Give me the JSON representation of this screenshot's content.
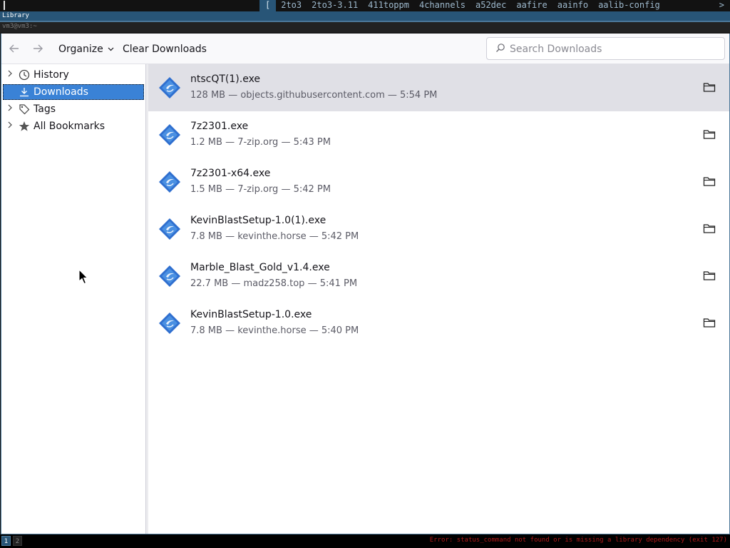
{
  "topbar": {
    "items": [
      "[",
      "2to3",
      "2to3-3.11",
      "411toppm",
      "4channels",
      "a52dec",
      "aafire",
      "aainfo",
      "aalib-config"
    ],
    "more": ">"
  },
  "window_title": "Library",
  "tab_title": "vm3@vm3:~",
  "toolbar": {
    "organize_label": "Organize",
    "clear_label": "Clear Downloads",
    "search_placeholder": "Search Downloads",
    "search_value": ""
  },
  "sidebar": {
    "items": [
      {
        "label": "History",
        "icon": "clock-icon",
        "expandable": true
      },
      {
        "label": "Downloads",
        "icon": "download-icon",
        "expandable": false,
        "selected": true
      },
      {
        "label": "Tags",
        "icon": "tag-icon",
        "expandable": true
      },
      {
        "label": "All Bookmarks",
        "icon": "star-icon",
        "expandable": true
      }
    ]
  },
  "downloads": [
    {
      "name": "ntscQT(1).exe",
      "meta": "128 MB — objects.githubusercontent.com — 5:54 PM",
      "selected": true
    },
    {
      "name": "7z2301.exe",
      "meta": "1.2 MB — 7-zip.org — 5:43 PM"
    },
    {
      "name": "7z2301-x64.exe",
      "meta": "1.5 MB — 7-zip.org — 5:42 PM"
    },
    {
      "name": "KevinBlastSetup-1.0(1).exe",
      "meta": "7.8 MB — kevinthe.horse — 5:42 PM"
    },
    {
      "name": "Marble_Blast_Gold_v1.4.exe",
      "meta": "22.7 MB — madz258.top — 5:41 PM"
    },
    {
      "name": "KevinBlastSetup-1.0.exe",
      "meta": "7.8 MB — kevinthe.horse — 5:40 PM"
    }
  ],
  "bottombar": {
    "workspaces": [
      "1",
      "2"
    ],
    "status": "Error: status_command not found or is missing a library dependency (exit 127)"
  },
  "colors": {
    "accent": "#3a82d6",
    "i3_focused": "#285577",
    "error": "#b01a1a"
  }
}
